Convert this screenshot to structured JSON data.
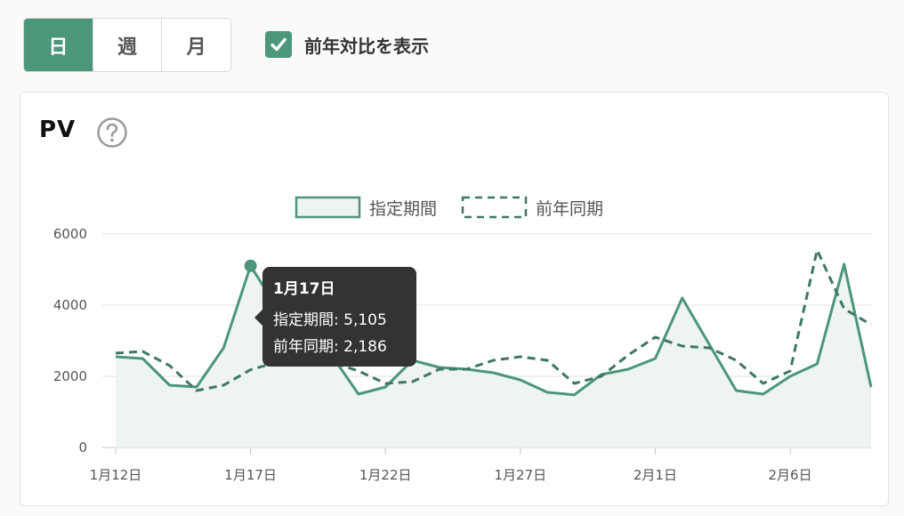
{
  "controls": {
    "period_tabs": [
      {
        "label": "日",
        "active": true
      },
      {
        "label": "週",
        "active": false
      },
      {
        "label": "月",
        "active": false
      }
    ],
    "yoy_checkbox": {
      "label": "前年対比を表示",
      "checked": true
    }
  },
  "card": {
    "title": "PV"
  },
  "tooltip": {
    "title": "1月17日",
    "rows": [
      {
        "label": "指定期間",
        "value": "5,105"
      },
      {
        "label": "前年同期",
        "value": "2,186"
      }
    ]
  },
  "colors": {
    "accent": "#4c9679",
    "fill": "#eef4f1",
    "tooltip_bg": "#333333"
  },
  "chart_data": {
    "type": "area",
    "x": [
      "1月12日",
      "1月13日",
      "1月14日",
      "1月15日",
      "1月16日",
      "1月17日",
      "1月18日",
      "1月19日",
      "1月20日",
      "1月21日",
      "1月22日",
      "1月23日",
      "1月24日",
      "1月25日",
      "1月26日",
      "1月27日",
      "1月28日",
      "1月29日",
      "1月30日",
      "1月31日",
      "2月1日",
      "2月2日",
      "2月3日",
      "2月4日",
      "2月5日",
      "2月6日",
      "2月7日",
      "2月8日",
      "2月9日"
    ],
    "xtick_labels": [
      "1月12日",
      "1月17日",
      "1月22日",
      "1月27日",
      "2月1日",
      "2月6日"
    ],
    "xticks_index": [
      0,
      5,
      10,
      15,
      20,
      25
    ],
    "ylim": [
      0,
      6000
    ],
    "yticks": [
      "0",
      "2000",
      "4000",
      "6000"
    ],
    "grid": true,
    "legend_position": "top",
    "highlight_index": 5,
    "series": [
      {
        "name": "指定期間",
        "style": "solid-area",
        "values": [
          2550,
          2500,
          1750,
          1700,
          2800,
          5105,
          3900,
          3100,
          2600,
          1500,
          1700,
          2450,
          2250,
          2200,
          2100,
          1900,
          1550,
          1480,
          2050,
          2200,
          2500,
          4200,
          2900,
          1600,
          1500,
          2000,
          2350,
          5150,
          1700
        ]
      },
      {
        "name": "前年同期",
        "style": "dashed",
        "values": [
          2650,
          2700,
          2300,
          1600,
          1750,
          2186,
          2400,
          2550,
          2400,
          2150,
          1800,
          1850,
          2200,
          2200,
          2450,
          2550,
          2450,
          1800,
          2000,
          2600,
          3100,
          2850,
          2800,
          2450,
          1800,
          2150,
          5550,
          3900,
          3450
        ]
      }
    ]
  }
}
